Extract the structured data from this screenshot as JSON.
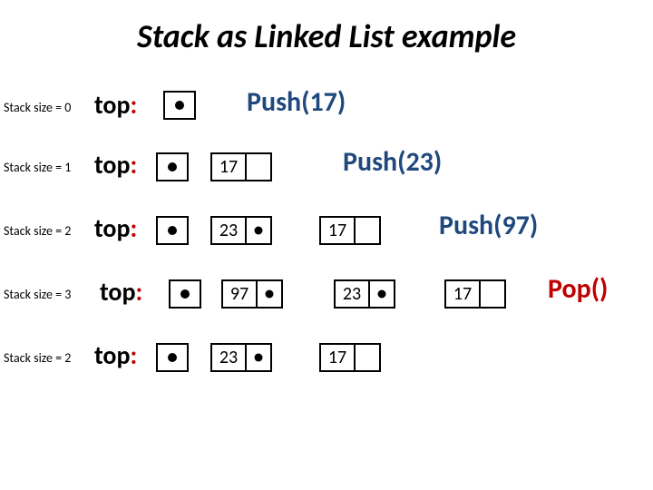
{
  "title": "Stack as  Linked List example",
  "rows": [
    {
      "size_label": "Stack size = 0",
      "top_label": "top",
      "op": "Push(17)",
      "nodes": []
    },
    {
      "size_label": "Stack size = 1",
      "top_label": "top",
      "op": "Push(23)",
      "nodes": [
        "17"
      ]
    },
    {
      "size_label": "Stack size = 2",
      "top_label": "top",
      "op": "Push(97)",
      "nodes": [
        "23",
        "17"
      ]
    },
    {
      "size_label": "Stack size = 3",
      "top_label": "top",
      "op": "Pop()",
      "nodes": [
        "97",
        "23",
        "17"
      ]
    },
    {
      "size_label": "Stack size = 2",
      "top_label": "top",
      "op": "",
      "nodes": [
        "23",
        "17"
      ]
    }
  ]
}
